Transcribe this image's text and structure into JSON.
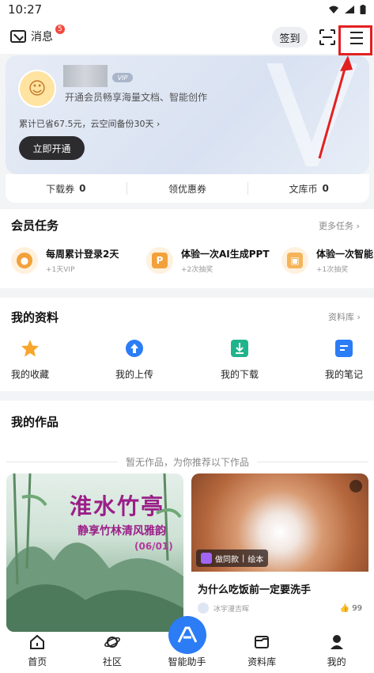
{
  "status": {
    "time": "10:27"
  },
  "header": {
    "messages_label": "消息",
    "messages_badge": "5",
    "signin_label": "签到"
  },
  "vip": {
    "tag": "VIP",
    "desc": "开通会员畅享海量文档、智能创作",
    "saved": "累计已省67.5元，云空间备份30天",
    "open_button": "立即开通"
  },
  "stats": [
    {
      "label": "下载券",
      "value": "0"
    },
    {
      "label": "领优惠券"
    },
    {
      "label": "文库币",
      "value": "0"
    }
  ],
  "tasks": {
    "title": "会员任务",
    "more": "更多任务",
    "items": [
      {
        "name": "每周累计登录2天",
        "reward": "+1天VIP",
        "icon": "person-badge-icon"
      },
      {
        "name": "体验一次AI生成PPT",
        "reward": "+2次抽奖",
        "icon": "ppt-icon",
        "glyph": "P"
      },
      {
        "name": "体验一次智能",
        "reward": "+1次抽奖",
        "icon": "image-doc-icon"
      }
    ]
  },
  "materials": {
    "title": "我的资料",
    "more": "资料库",
    "items": [
      {
        "label": "我的收藏",
        "icon": "star-icon"
      },
      {
        "label": "我的上传",
        "icon": "cloud-upload-icon"
      },
      {
        "label": "我的下载",
        "icon": "download-icon"
      },
      {
        "label": "我的笔记",
        "icon": "note-icon"
      }
    ]
  },
  "works": {
    "title": "我的作品",
    "empty_hint": "暂无作品，为你推荐以下作品",
    "card1": {
      "title": "淮水竹亭",
      "subtitle": "静享竹林清风雅韵",
      "date": "(06/01)"
    },
    "card2": {
      "tag_left": "做同款",
      "tag_right": "绘本",
      "title": "为什么吃饭前一定要洗手",
      "author": "冰宇漫吉晖",
      "likes": "99"
    }
  },
  "nav": [
    {
      "label": "首页",
      "icon": "home-icon"
    },
    {
      "label": "社区",
      "icon": "planet-icon"
    },
    {
      "label": "智能助手",
      "icon": "ai-assistant-icon"
    },
    {
      "label": "资料库",
      "icon": "library-icon"
    },
    {
      "label": "我的",
      "icon": "profile-icon"
    }
  ],
  "colors": {
    "accent": "#2b7cf5",
    "highlight": "#e32020",
    "task_orange": "#f2a13a"
  }
}
